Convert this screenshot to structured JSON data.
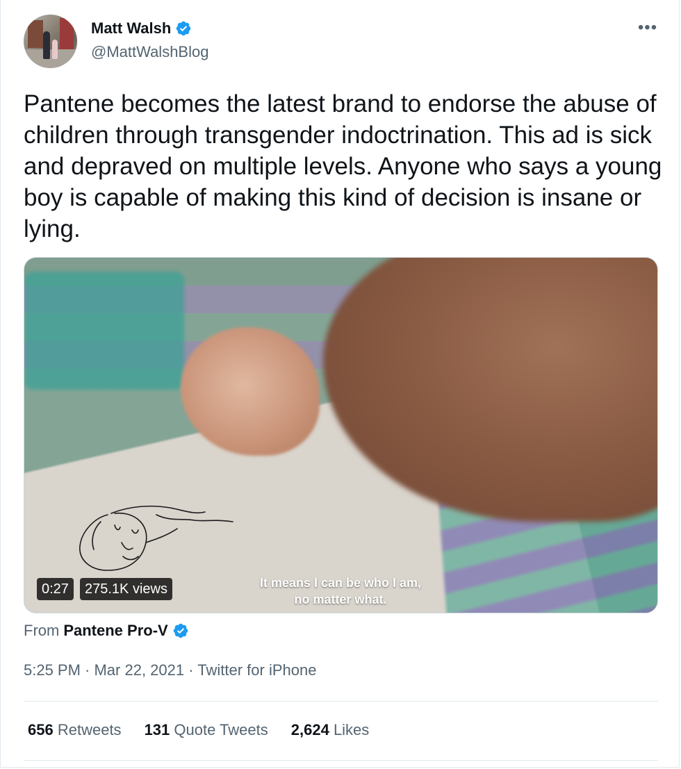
{
  "author": {
    "name": "Matt Walsh",
    "handle": "@MattWalshBlog",
    "verified": true,
    "avatar_icon": "profile-photo"
  },
  "menu_icon": "more-options-icon",
  "tweet": {
    "text": "Pantene becomes the latest brand to endorse the abuse of children through transgender indoctrination. This ad is sick and depraved on multiple levels. Anyone who says a young boy is capable of making this kind of decision is insane or lying."
  },
  "video": {
    "duration": "0:27",
    "views": "275.1K views",
    "subtitle_line1": "It means I can be who I am,",
    "subtitle_line2": "no matter what."
  },
  "source": {
    "prefix": "From",
    "name": "Pantene Pro-V",
    "verified": true
  },
  "meta": {
    "line": "5:25 PM · Mar 22, 2021 · Twitter for iPhone"
  },
  "stats": {
    "retweets_count": "656",
    "retweets_label": "Retweets",
    "quotes_count": "131",
    "quotes_label": "Quote Tweets",
    "likes_count": "2,624",
    "likes_label": "Likes"
  },
  "colors": {
    "verified_blue": "#1d9bf0",
    "secondary_text": "#536471",
    "primary_text": "#0f1419"
  }
}
